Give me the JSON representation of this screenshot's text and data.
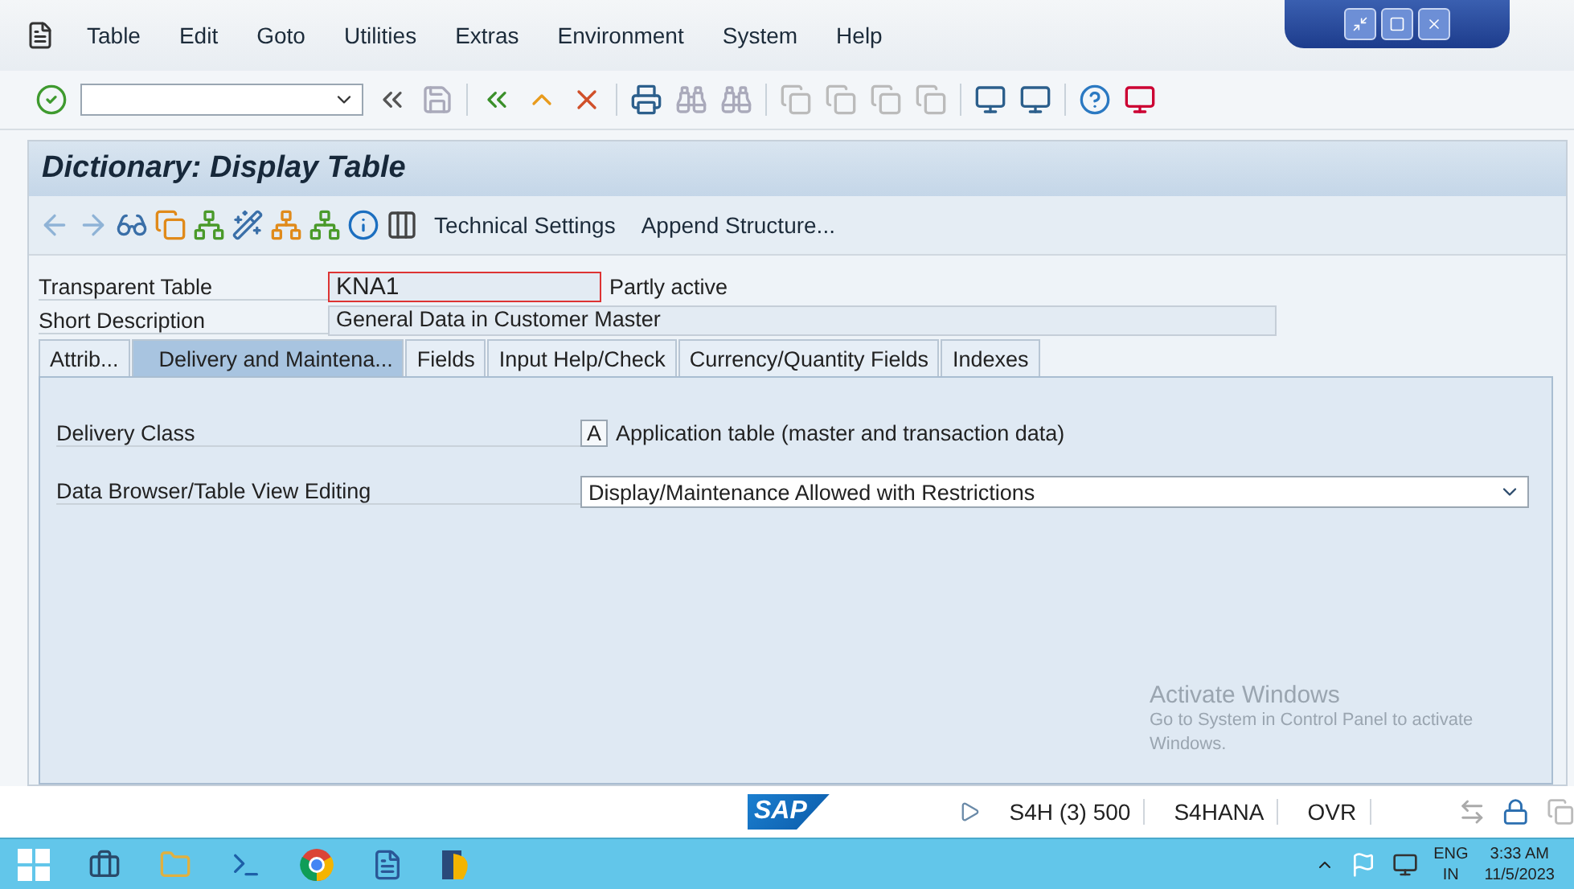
{
  "menu": [
    "Table",
    "Edit",
    "Goto",
    "Utilities",
    "Extras",
    "Environment",
    "System",
    "Help"
  ],
  "title": "Dictionary: Display Table",
  "app_toolbar": [
    "Technical Settings",
    "Append Structure..."
  ],
  "header_fields": [
    {
      "label": "Transparent Table",
      "value": "KNA1",
      "status": "Partly active"
    },
    {
      "label": "Short Description",
      "value": "General Data in Customer Master"
    }
  ],
  "tabs": [
    {
      "label": "Attrib...",
      "selected": false
    },
    {
      "label": "Delivery and Maintena...",
      "selected": true
    },
    {
      "label": "Fields",
      "selected": false
    },
    {
      "label": "Input Help/Check",
      "selected": false
    },
    {
      "label": "Currency/Quantity Fields",
      "selected": false
    },
    {
      "label": "Indexes",
      "selected": false
    }
  ],
  "delivery_class": {
    "label": "Delivery Class",
    "key": "A",
    "text": "Application table (master and transaction data)"
  },
  "data_browser": {
    "label": "Data Browser/Table View Editing",
    "value": "Display/Maintenance Allowed with Restrictions"
  },
  "activation_notice": {
    "title": "Activate Windows",
    "text": "Go to System in Control Panel to activate Windows."
  },
  "status_bar": {
    "logo": "SAP",
    "session": "S4H (3) 500",
    "server": "S4HANA",
    "mode": "OVR"
  },
  "taskbar": {
    "language": "ENG",
    "region": "IN",
    "time": "3:33 AM",
    "date": "11/5/2023"
  }
}
